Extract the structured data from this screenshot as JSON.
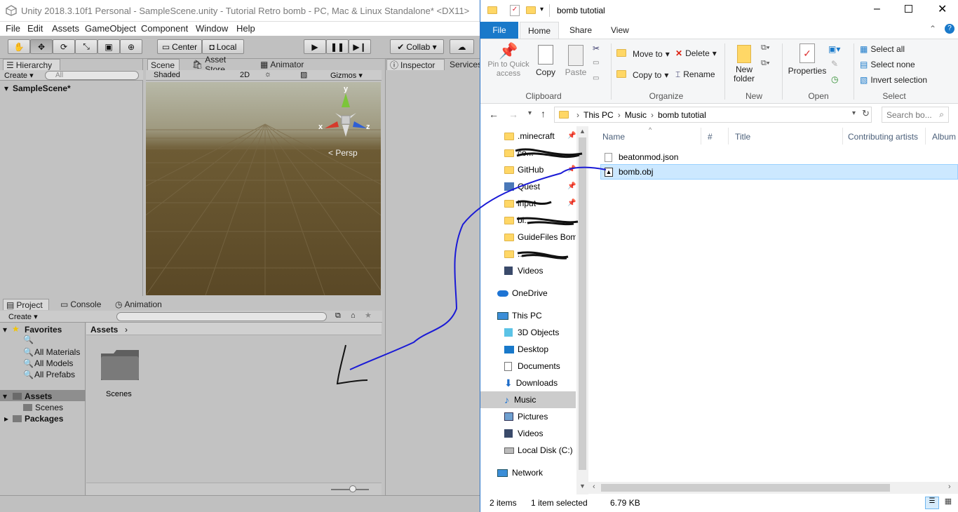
{
  "unity": {
    "title": "Unity 2018.3.10f1 Personal - SampleScene.unity - Tutorial Retro bomb - PC, Mac & Linux Standalone* <DX11>",
    "menu": [
      "File",
      "Edit",
      "Assets",
      "GameObject",
      "Component",
      "Window",
      "Help"
    ],
    "toolbar": {
      "pivot_center": "Center",
      "pivot_local": "Local",
      "collab": "Collab ▾"
    },
    "hierarchy": {
      "tab": "Hierarchy",
      "create": "Create ▾",
      "search_placeholder": "All",
      "scene_name": "SampleScene*"
    },
    "scene": {
      "tabs": [
        "Scene",
        "Asset Store",
        "Animator"
      ],
      "shading": "Shaded",
      "mode_2d": "2D",
      "gizmos": "Gizmos ▾",
      "persp": "Persp",
      "axis_x": "x",
      "axis_y": "y",
      "axis_z": "z"
    },
    "inspector": {
      "tabs": [
        "Inspector",
        "Services"
      ]
    },
    "project": {
      "tabs": [
        "Project",
        "Console",
        "Animation"
      ],
      "create": "Create ▾",
      "favorites": "Favorites",
      "fav_items": [
        "All Materials",
        "All Models",
        "All Prefabs"
      ],
      "assets": "Assets",
      "scenes": "Scenes",
      "packages": "Packages",
      "breadcrumb": "Assets",
      "folder_label": "Scenes"
    }
  },
  "explorer": {
    "title": "bomb tutotial",
    "tabs": [
      "File",
      "Home",
      "Share",
      "View"
    ],
    "ribbon": {
      "pin": "Pin to Quick access",
      "copy": "Copy",
      "paste": "Paste",
      "clipboard": "Clipboard",
      "move_to": "Move to",
      "copy_to": "Copy to",
      "delete": "Delete",
      "rename": "Rename",
      "organize": "Organize",
      "new_folder": "New folder",
      "new": "New",
      "properties": "Properties",
      "open": "Open",
      "select_all": "Select all",
      "select_none": "Select none",
      "invert_selection": "Invert selection",
      "select": "Select"
    },
    "address": {
      "path": [
        "This PC",
        "Music",
        "bomb tutotial"
      ],
      "search_placeholder": "Search bo..."
    },
    "nav": {
      "quick": [
        ".minecraft",
        "co...",
        "GitHub",
        "Quest",
        "input",
        "bl...",
        "GuideFiles Boml",
        "...",
        "Videos"
      ],
      "onedrive": "OneDrive",
      "thispc": "This PC",
      "pc_items": [
        "3D Objects",
        "Desktop",
        "Documents",
        "Downloads",
        "Music",
        "Pictures",
        "Videos",
        "Local Disk (C:)"
      ],
      "network": "Network"
    },
    "columns": [
      "Name",
      "#",
      "Title",
      "Contributing artists",
      "Album"
    ],
    "files": [
      {
        "name": "beatonmod.json",
        "selected": false
      },
      {
        "name": "bomb.obj",
        "selected": true
      }
    ],
    "status": {
      "count": "2 items",
      "selected": "1 item selected",
      "size": "6.79 KB"
    }
  },
  "colors": {
    "unity_bg": "#c2c2c2",
    "explorer_accent": "#1979ca",
    "selection": "#cce8ff",
    "annotation": "#1a1ad6"
  }
}
